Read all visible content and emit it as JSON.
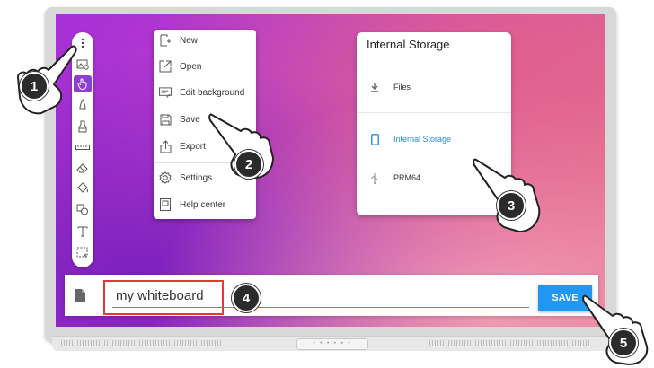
{
  "file_menu": {
    "items": [
      {
        "label": "New",
        "icon": "new-file-icon"
      },
      {
        "label": "Open",
        "icon": "open-icon"
      },
      {
        "label": "Edit background",
        "icon": "edit-background-icon"
      },
      {
        "label": "Save",
        "icon": "save-icon"
      },
      {
        "label": "Export",
        "icon": "export-icon"
      },
      {
        "label": "Settings",
        "icon": "settings-icon"
      },
      {
        "label": "Help center",
        "icon": "help-center-icon"
      }
    ]
  },
  "storage_popup": {
    "title": "Internal Storage",
    "items": [
      {
        "label": "Files",
        "icon": "download-icon"
      },
      {
        "label": "Internal Storage",
        "icon": "phone-icon",
        "selected": true
      },
      {
        "label": "PRM64",
        "icon": "usb-icon"
      }
    ]
  },
  "save_bar": {
    "filename": "my whiteboard",
    "save_label": "SAVE"
  },
  "steps": [
    "1",
    "2",
    "3",
    "4",
    "5"
  ],
  "colors": {
    "accent": "#2196f3",
    "active_tool": "#8e3fd2",
    "highlight_box": "#e53935",
    "badge": "#2b2b2b"
  }
}
